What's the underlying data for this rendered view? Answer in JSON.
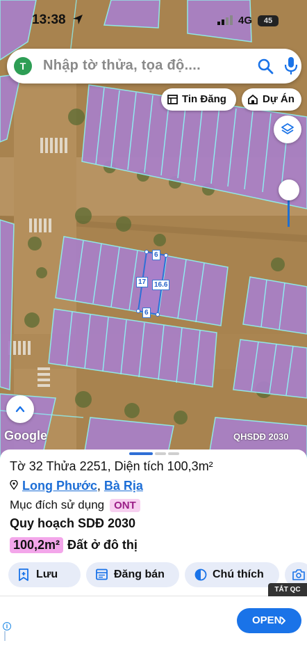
{
  "status_bar": {
    "time": "13:38",
    "network": "4G",
    "battery": "45"
  },
  "search": {
    "avatar_letter": "T",
    "placeholder": "Nhập tờ thửa, tọa độ...."
  },
  "chips": {
    "listings": "Tin Đăng",
    "projects": "Dự Án"
  },
  "map": {
    "attribution": "Google",
    "plan_layer": "QHSDĐ 2030",
    "dimensions": {
      "top": "6",
      "bottom": "6",
      "left": "17",
      "right": "16.6"
    },
    "colors": {
      "planned_residential": "#a980c9",
      "parcel_border": "#8ef0f2",
      "selected_border": "#2f6fd6",
      "road": "#b08a55"
    }
  },
  "sheet": {
    "title": "Tờ 32 Thửa 2251, Diện tích 100,3m²",
    "ward": "Long Phước",
    "separator": ", ",
    "city": "Bà Rịa",
    "purpose_label": "Mục đích sử dụng",
    "purpose_code": "ONT",
    "plan_heading": "Quy hoạch SDĐ 2030",
    "plan_area": "100,2m²",
    "plan_use": "Đất ở đô thị",
    "buttons": {
      "save": "Lưu",
      "post_sale": "Đăng bán",
      "legend": "Chú thích"
    }
  },
  "ad": {
    "close_label": "TẮT QC",
    "cta": "OPEN",
    "info": "i"
  }
}
